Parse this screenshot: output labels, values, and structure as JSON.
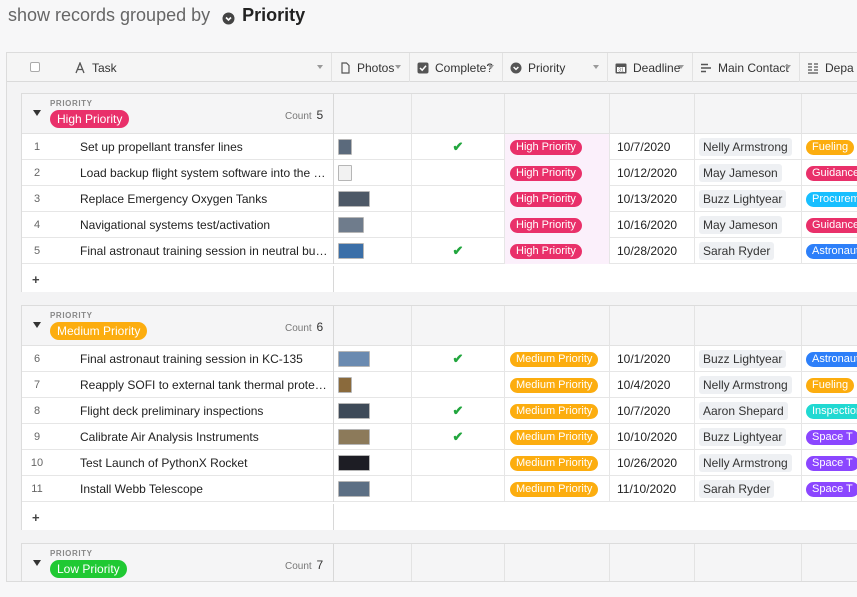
{
  "heading": {
    "prefix": "show records grouped by",
    "field_icon": "priority-field-icon",
    "field": "Priority"
  },
  "columns": [
    {
      "key": "task",
      "label": "Task",
      "icon": "text-field-icon"
    },
    {
      "key": "photos",
      "label": "Photos",
      "icon": "attachment-icon"
    },
    {
      "key": "complete",
      "label": "Complete?",
      "icon": "checkbox-icon"
    },
    {
      "key": "priority",
      "label": "Priority",
      "icon": "single-select-icon"
    },
    {
      "key": "deadline",
      "label": "Deadline",
      "icon": "calendar-icon"
    },
    {
      "key": "contact",
      "label": "Main Contact",
      "icon": "link-records-icon"
    },
    {
      "key": "dept",
      "label": "Depa",
      "icon": "lookup-icon"
    }
  ],
  "colors": {
    "high": "#e9306a",
    "medium": "#fcad0f",
    "low": "#20c933",
    "check": "#22a63e",
    "dept_orange": "#fcad0f",
    "dept_red": "#e9306a",
    "dept_cyan": "#18bfff",
    "dept_blue": "#2d7ff9",
    "dept_teal": "#20d9d2",
    "dept_purple": "#8b46ff"
  },
  "groups": [
    {
      "field_label": "PRIORITY",
      "value": "High Priority",
      "color": "#e9306a",
      "count_label": "Count",
      "count": "5",
      "rows": [
        {
          "num": "1",
          "task": "Set up propellant transfer lines",
          "photo": "narrow",
          "photo_color": "#5b6a7c",
          "complete": true,
          "priority": "High Priority",
          "deadline": "10/7/2020",
          "contact": "Nelly Armstrong",
          "dept": "Fueling",
          "dept_color": "#fcad0f"
        },
        {
          "num": "2",
          "task": "Load backup flight system software into the orbi...",
          "photo": "narrow",
          "photo_color": "#f2f2f2",
          "complete": false,
          "priority": "High Priority",
          "deadline": "10/12/2020",
          "contact": "May Jameson",
          "dept": "Guidance",
          "dept_color": "#e9306a"
        },
        {
          "num": "3",
          "task": "Replace Emergency Oxygen Tanks",
          "photo": "wide",
          "photo_color": "#4d5866",
          "complete": false,
          "priority": "High Priority",
          "deadline": "10/13/2020",
          "contact": "Buzz Lightyear",
          "dept": "Procurement",
          "dept_color": "#18bfff"
        },
        {
          "num": "4",
          "task": "Navigational systems test/activation",
          "photo": "mid",
          "photo_color": "#6f7c8c",
          "complete": false,
          "priority": "High Priority",
          "deadline": "10/16/2020",
          "contact": "May Jameson",
          "dept": "Guidance",
          "dept_color": "#e9306a"
        },
        {
          "num": "5",
          "task": "Final astronaut training session in neutral buoya...",
          "photo": "mid",
          "photo_color": "#3b6fa8",
          "complete": true,
          "priority": "High Priority",
          "deadline": "10/28/2020",
          "contact": "Sarah Ryder",
          "dept": "Astronaut",
          "dept_color": "#2d7ff9"
        }
      ]
    },
    {
      "field_label": "PRIORITY",
      "value": "Medium Priority",
      "color": "#fcad0f",
      "count_label": "Count",
      "count": "6",
      "rows": [
        {
          "num": "6",
          "task": "Final astronaut training session in KC-135",
          "photo": "wide",
          "photo_color": "#6a8ab0",
          "complete": true,
          "priority": "Medium Priority",
          "deadline": "10/1/2020",
          "contact": "Buzz Lightyear",
          "dept": "Astronaut",
          "dept_color": "#2d7ff9"
        },
        {
          "num": "7",
          "task": "Reapply SOFI to external tank thermal protectio...",
          "photo": "narrow",
          "photo_color": "#8a6a3c",
          "complete": false,
          "priority": "Medium Priority",
          "deadline": "10/4/2020",
          "contact": "Nelly Armstrong",
          "dept": "Fueling",
          "dept_color": "#fcad0f"
        },
        {
          "num": "8",
          "task": "Flight deck preliminary inspections",
          "photo": "wide",
          "photo_color": "#3e4a58",
          "complete": true,
          "priority": "Medium Priority",
          "deadline": "10/7/2020",
          "contact": "Aaron Shepard",
          "dept": "Inspection",
          "dept_color": "#20d9d2"
        },
        {
          "num": "9",
          "task": "Calibrate Air Analysis Instruments",
          "photo": "wide",
          "photo_color": "#8c7a5a",
          "complete": true,
          "priority": "Medium Priority",
          "deadline": "10/10/2020",
          "contact": "Buzz Lightyear",
          "dept": "Space T",
          "dept_color": "#8b46ff"
        },
        {
          "num": "10",
          "task": "Test Launch of PythonX Rocket",
          "photo": "wide",
          "photo_color": "#1d1d24",
          "complete": false,
          "priority": "Medium Priority",
          "deadline": "10/26/2020",
          "contact": "Nelly Armstrong",
          "dept": "Space T",
          "dept_color": "#8b46ff"
        },
        {
          "num": "11",
          "task": "Install Webb Telescope",
          "photo": "wide",
          "photo_color": "#5c6f84",
          "complete": false,
          "priority": "Medium Priority",
          "deadline": "11/10/2020",
          "contact": "Sarah Ryder",
          "dept": "Space T",
          "dept_color": "#8b46ff"
        }
      ]
    },
    {
      "field_label": "PRIORITY",
      "value": "Low Priority",
      "color": "#20c933",
      "count_label": "Count",
      "count": "7",
      "rows": []
    }
  ]
}
